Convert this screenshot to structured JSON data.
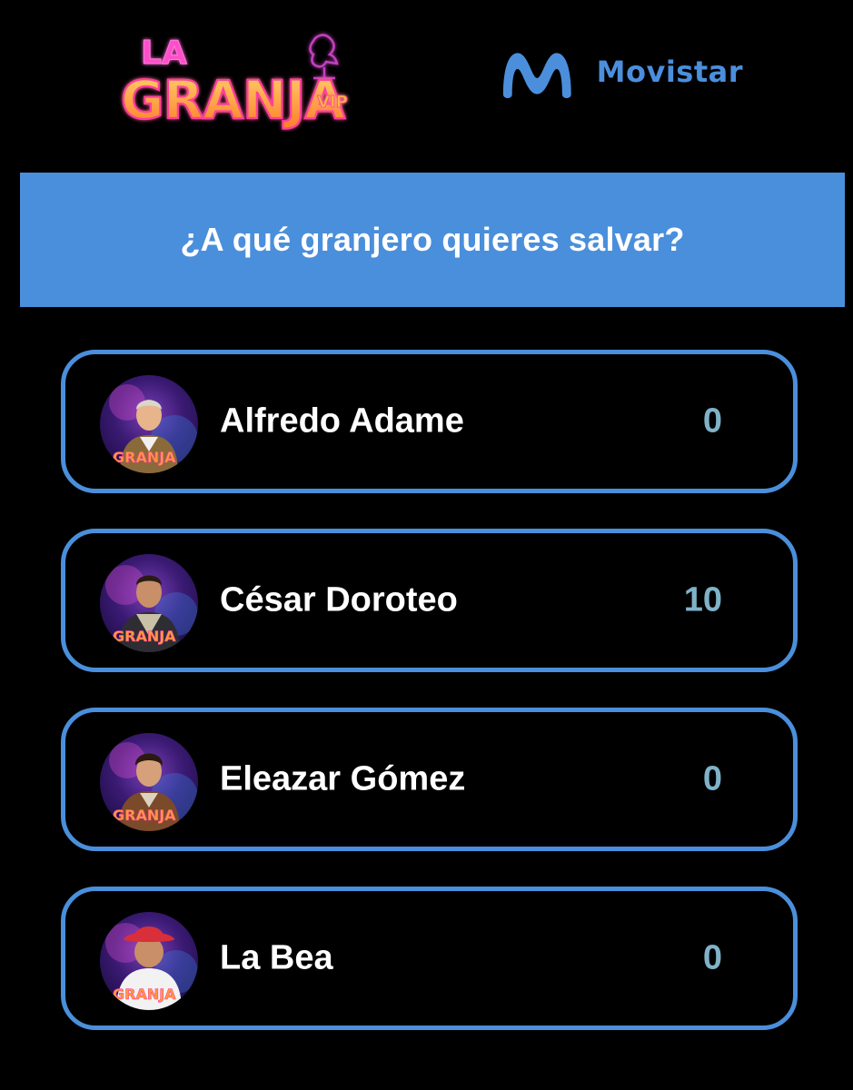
{
  "header": {
    "show_logo": {
      "line1": "LA",
      "line2": "GRANJA",
      "badge": "VIP"
    },
    "sponsor_logo": {
      "wordmark": "Movistar",
      "icon": "movistar-m-icon",
      "color": "#4b8fdc"
    }
  },
  "poll": {
    "question": "¿A qué granjero quieres salvar?",
    "accent_color": "#4a8fdb",
    "vote_color": "#7fb2c8",
    "options": [
      {
        "name": "Alfredo Adame",
        "votes": "0",
        "avatar": "avatar-alfredo-adame"
      },
      {
        "name": "César Doroteo",
        "votes": "10",
        "avatar": "avatar-cesar-doroteo"
      },
      {
        "name": "Eleazar Gómez",
        "votes": "0",
        "avatar": "avatar-eleazar-gomez"
      },
      {
        "name": "La Bea",
        "votes": "0",
        "avatar": "avatar-la-bea"
      }
    ]
  }
}
